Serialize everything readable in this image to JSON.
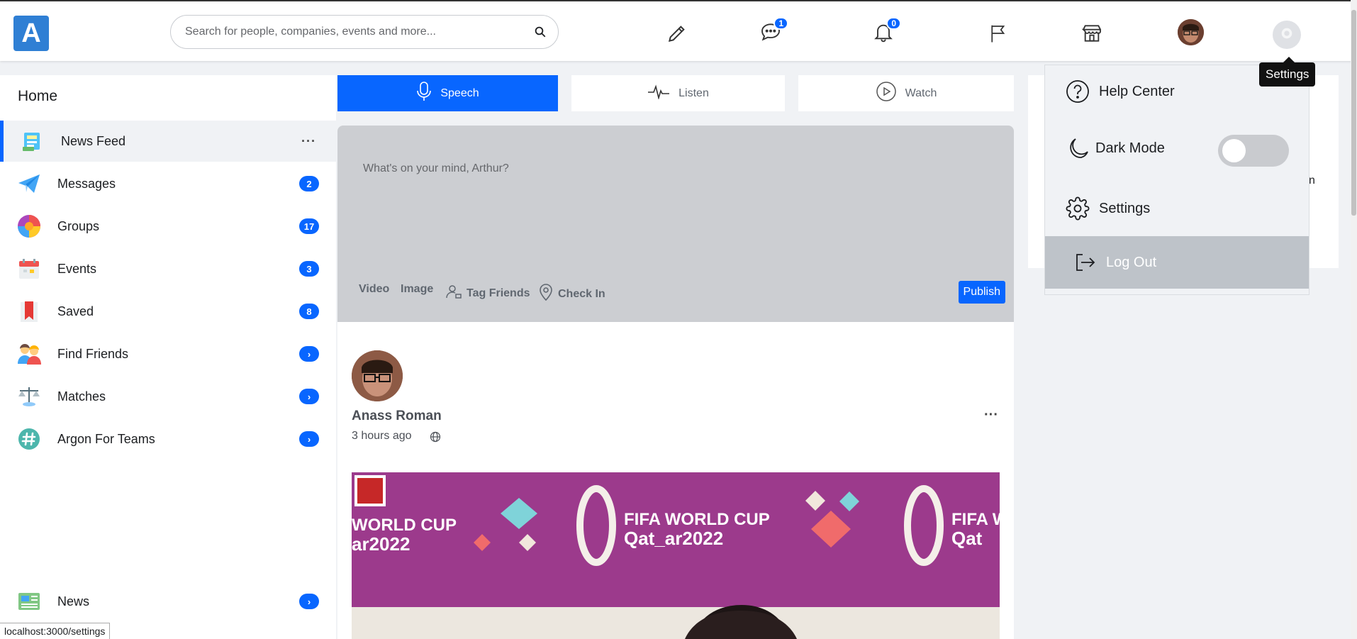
{
  "header": {
    "logo_letter": "A",
    "search_placeholder": "Search for people, companies, events and more...",
    "messages_badge": "1",
    "notifications_badge": "0"
  },
  "sidebar": {
    "title": "Home",
    "items": [
      {
        "label": "News Feed",
        "icon": "news-feed-icon",
        "more": "···"
      },
      {
        "label": "Messages",
        "icon": "paper-plane-icon",
        "count": "2"
      },
      {
        "label": "Groups",
        "icon": "groups-icon",
        "count": "17"
      },
      {
        "label": "Events",
        "icon": "calendar-icon",
        "count": "3"
      },
      {
        "label": "Saved",
        "icon": "bookmark-icon",
        "count": "8"
      },
      {
        "label": "Find Friends",
        "icon": "find-friends-icon",
        "count": "›"
      },
      {
        "label": "Matches",
        "icon": "scales-icon",
        "count": "›"
      },
      {
        "label": "Argon For Teams",
        "icon": "hashtag-icon",
        "count": "›"
      },
      {
        "label": "News",
        "icon": "newspaper-icon",
        "count": "›"
      }
    ]
  },
  "media_tabs": [
    {
      "label": "Speech",
      "icon": "microphone-icon"
    },
    {
      "label": "Listen",
      "icon": "waveform-icon"
    },
    {
      "label": "Watch",
      "icon": "play-circle-icon"
    }
  ],
  "composer": {
    "placeholder": "What's on your mind, Arthur?",
    "actions": [
      "Video",
      "Image",
      "Tag Friends",
      "Check In"
    ],
    "publish_label": "Publish"
  },
  "post": {
    "author": "Anass Roman",
    "time": "3 hours ago",
    "more": "···",
    "banner_text_1": "FIFA WORLD CUP",
    "banner_text_2": "Qat_ar2022",
    "banner_left_1": "WORLD CUP",
    "banner_left_2": "ar2022",
    "banner_right_1": "FIFA W",
    "banner_right_2": "Qat"
  },
  "right_card": {
    "partial_text": "n"
  },
  "settings_menu": {
    "items": [
      "Help Center",
      "Dark Mode",
      "Settings",
      "Log Out"
    ],
    "dark_mode_on": false
  },
  "tooltip": "Settings",
  "status_url": "localhost:3000/settings",
  "colors": {
    "primary": "#0866ff",
    "logo": "#2f7fd4",
    "composer_bg": "#ccced2",
    "banner": "#9e3c8e"
  }
}
